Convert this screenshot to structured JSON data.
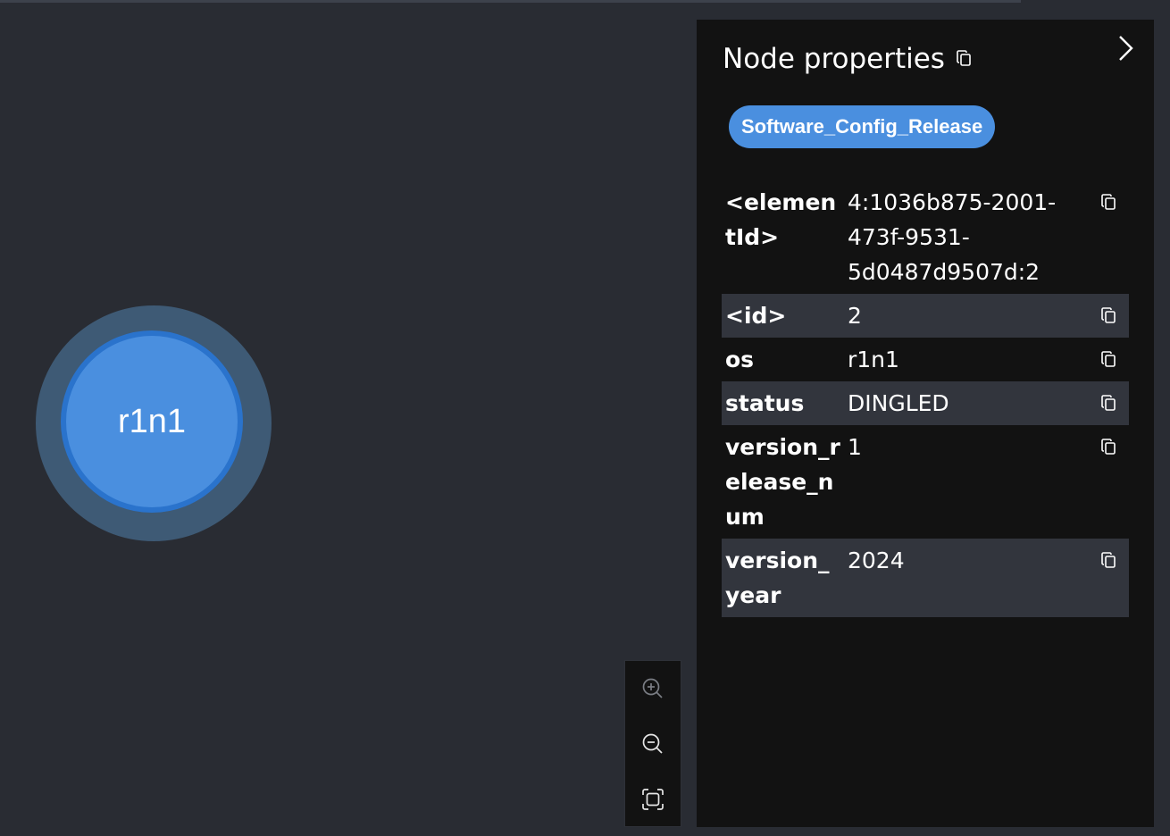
{
  "graph": {
    "node_label": "r1n1",
    "node_color": "#4a8fdf"
  },
  "zoom_controls": {
    "zoom_in_icon": "zoom-in-icon",
    "zoom_out_icon": "zoom-out-icon",
    "fit_icon": "fit-to-screen-icon"
  },
  "panel": {
    "title": "Node properties",
    "close_icon": "chevron-right-icon",
    "label": "Software_Config_Release",
    "label_color": "#4a8fdf",
    "properties": [
      {
        "key": "<elementId>",
        "value": "4:1036b875-2001-473f-9531-5d0487d9507d:2"
      },
      {
        "key": "<id>",
        "value": "2"
      },
      {
        "key": "os",
        "value": "r1n1"
      },
      {
        "key": "status",
        "value": "DINGLED"
      },
      {
        "key": "version_release_num",
        "value": "1"
      },
      {
        "key": "version_year",
        "value": "2024"
      }
    ]
  }
}
